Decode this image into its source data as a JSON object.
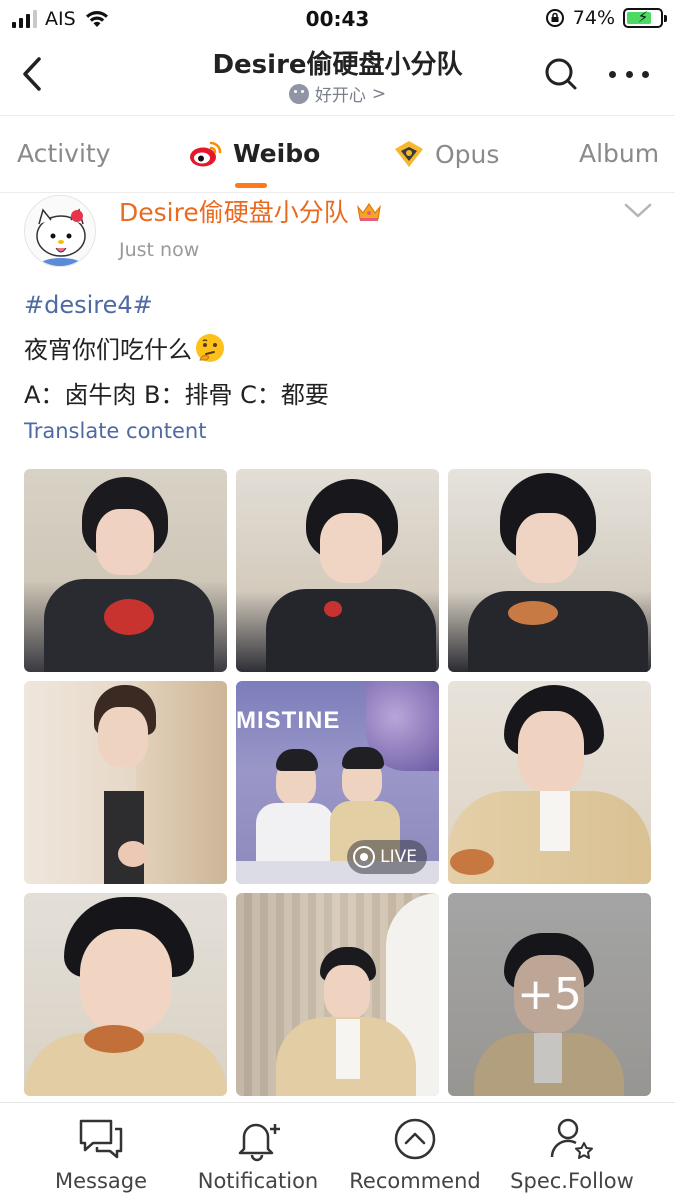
{
  "status_bar": {
    "carrier": "AIS",
    "time": "00:43",
    "battery": "74%"
  },
  "header": {
    "title": "Desire偷硬盘小分队",
    "subtitle": "好开心",
    "subtitle_chevron": ">"
  },
  "tabs": [
    {
      "label": "Activity",
      "active": false
    },
    {
      "label": "Weibo",
      "active": true,
      "icon": "weibo-icon"
    },
    {
      "label": "Opus",
      "active": false,
      "icon": "opus-icon"
    },
    {
      "label": "Album",
      "active": false
    }
  ],
  "post": {
    "author": "Desire偷硬盘小分队",
    "time": "Just now",
    "hashtag": "#desire4#",
    "text_line1": "夜宵你们吃什么",
    "text_line2": "A：卤牛肉  B：排骨  C：都要",
    "translate": "Translate content",
    "images": [
      {
        "alt": "photo-1"
      },
      {
        "alt": "photo-2"
      },
      {
        "alt": "photo-3"
      },
      {
        "alt": "photo-4"
      },
      {
        "alt": "photo-5",
        "badge": "LIVE",
        "stage_text": "MISTINE"
      },
      {
        "alt": "photo-6"
      },
      {
        "alt": "photo-7"
      },
      {
        "alt": "photo-8"
      },
      {
        "alt": "photo-9",
        "overlay": "+5"
      }
    ]
  },
  "bottom_bar": [
    {
      "label": "Message",
      "icon": "message-icon"
    },
    {
      "label": "Notification",
      "icon": "notification-icon"
    },
    {
      "label": "Recommend",
      "icon": "recommend-icon"
    },
    {
      "label": "Spec.Follow",
      "icon": "special-follow-icon"
    }
  ],
  "colors": {
    "accent": "#ff7a1a",
    "author": "#ea6a1f",
    "link": "#4f6aa3"
  }
}
